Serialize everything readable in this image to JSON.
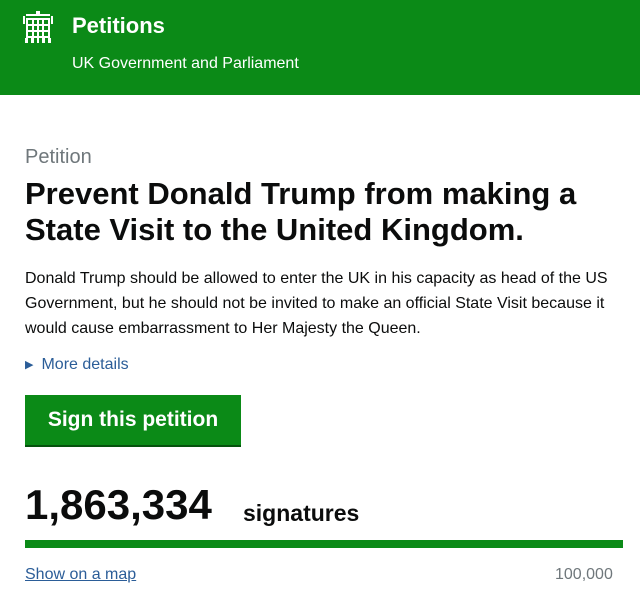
{
  "header": {
    "title": "Petitions",
    "subtitle": "UK Government and Parliament",
    "brand_color": "#0b8a17",
    "logo_icon": "portcullis-icon"
  },
  "petition": {
    "kicker": "Petition",
    "title": "Prevent Donald Trump from making a State Visit to the United Kingdom.",
    "summary": "Donald Trump should be allowed to enter the UK in his capacity as head of the US Government, but he should not be invited to make an official State Visit because it would cause embarrassment to Her Majesty the Queen.",
    "more_details_label": "More details",
    "more_details_icon": "triangle-right-icon",
    "sign_button_label": "Sign this petition"
  },
  "signatures": {
    "count": "1,863,334",
    "label": "signatures",
    "target": "100,000",
    "progress_fraction": 1.0,
    "map_link_label": "Show on a map"
  },
  "colors": {
    "link": "#2b5d98",
    "secondary_text": "#6f777b",
    "progress_track": "#dee0e2"
  }
}
